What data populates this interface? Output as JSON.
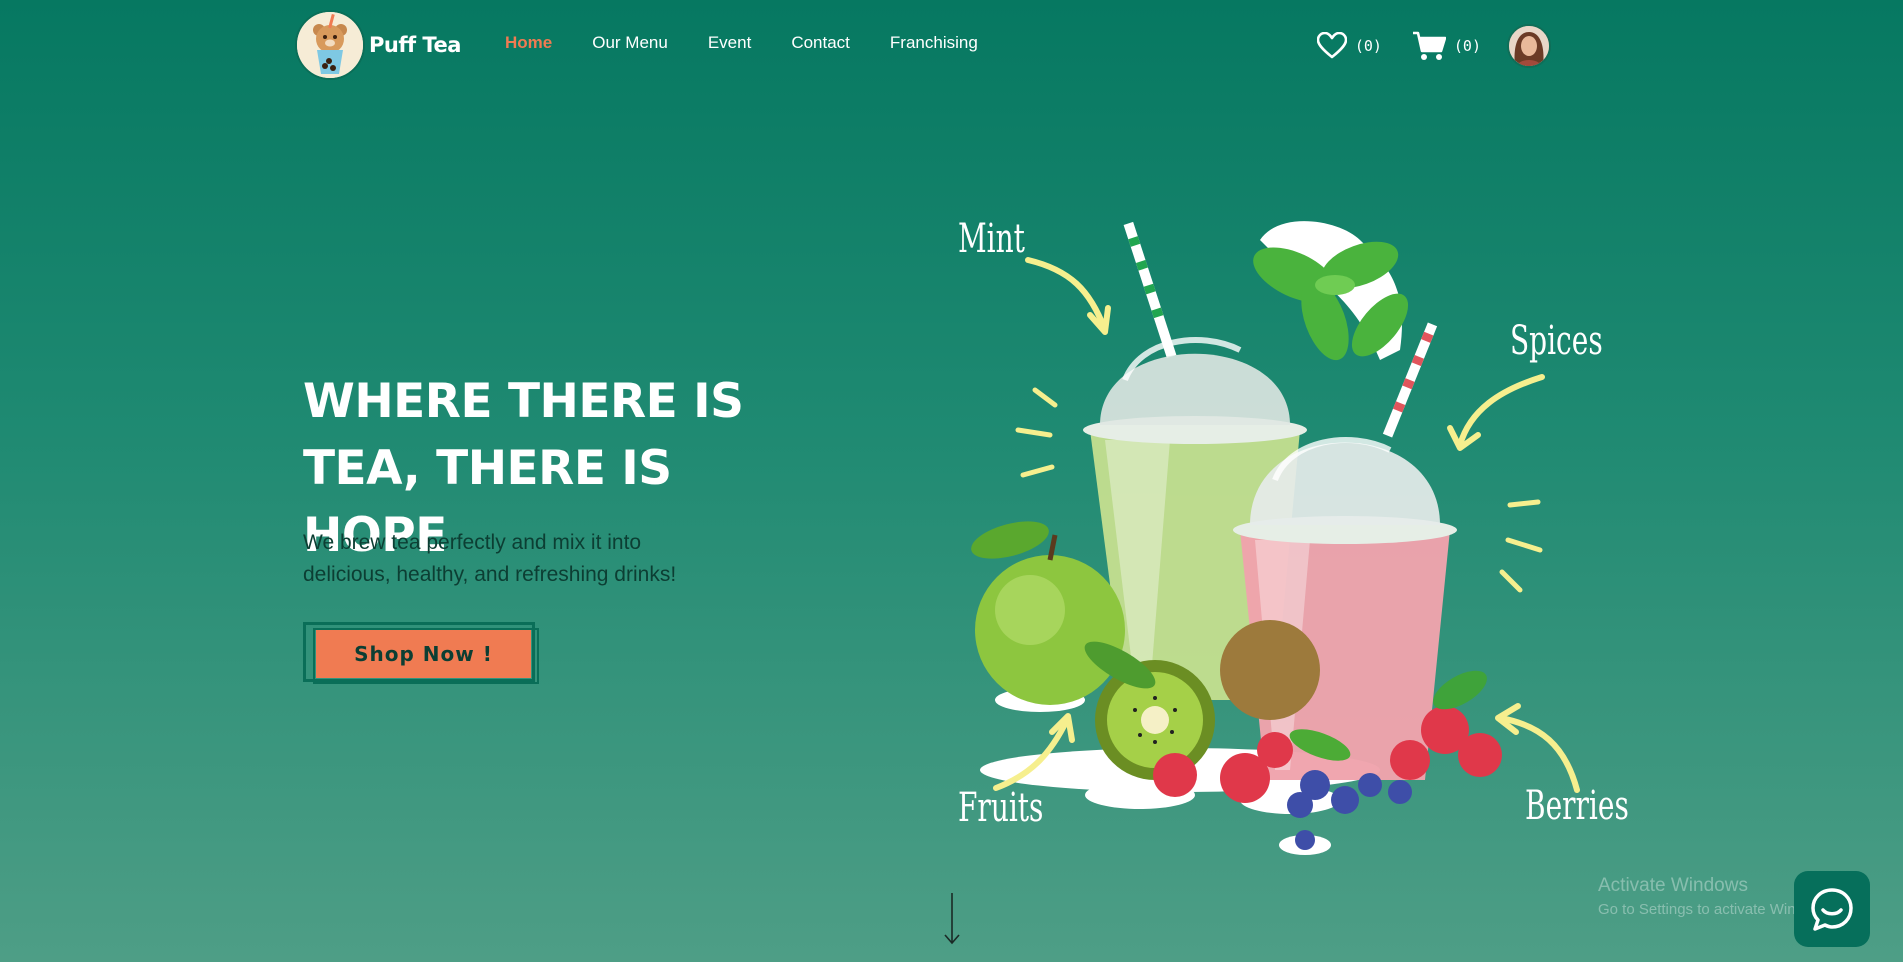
{
  "brand": {
    "name": "Puff Tea",
    "logo_icon": "bubble-tea-bear-logo"
  },
  "nav": {
    "items": [
      {
        "label": "Home",
        "active": true
      },
      {
        "label": "Our Menu",
        "active": false
      },
      {
        "label": "Event",
        "active": false
      },
      {
        "label": "Contact",
        "active": false
      },
      {
        "label": "Franchising",
        "active": false
      }
    ]
  },
  "header_icons": {
    "wishlist": {
      "icon": "heart-icon",
      "count": "(0)"
    },
    "cart": {
      "icon": "cart-icon",
      "count": "(0)"
    },
    "avatar": "user-avatar"
  },
  "hero": {
    "title_line1": "WHERE THERE IS",
    "title_line2": "TEA, THERE IS HOPE",
    "subtitle_line1": "We brew tea perfectly and mix it into",
    "subtitle_line2": "delicious, healthy, and refreshing drinks!",
    "cta_label": "Shop Now !"
  },
  "illustration": {
    "labels": {
      "mint": "Mint",
      "spices": "Spices",
      "fruits": "Fruits",
      "berries": "Berries"
    }
  },
  "scroll_icon": "arrow-down-icon",
  "windows_notice": {
    "line1": "Activate Windows",
    "line2": "Go to Settings to activate Windows."
  },
  "chat_icon": "chat-bubble-icon",
  "colors": {
    "accent": "#f07b52",
    "brand_green": "#067861",
    "dark_text": "#0c3e33",
    "label_yellow": "#f6ef8e"
  }
}
